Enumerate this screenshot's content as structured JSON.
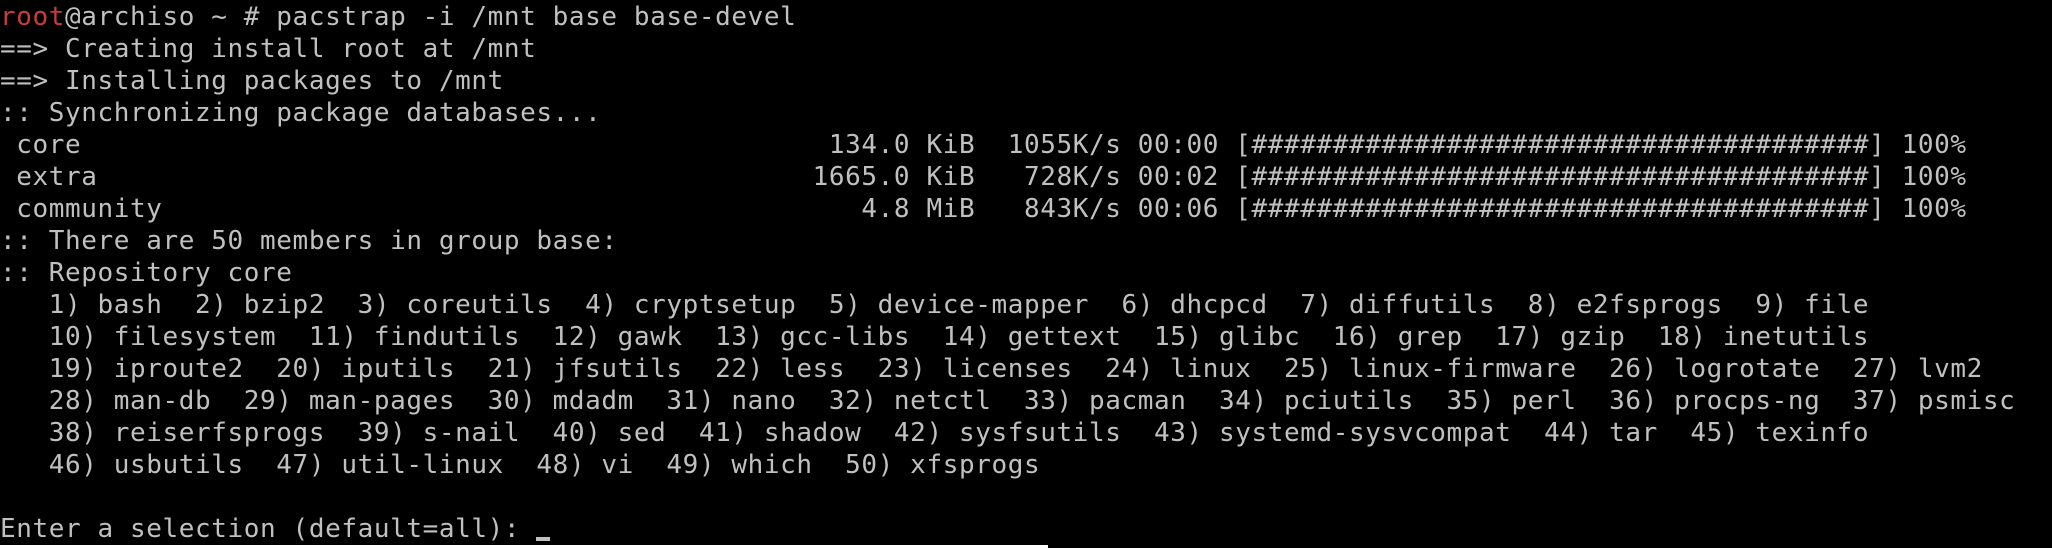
{
  "terminal": {
    "prompt": {
      "user": "root",
      "host_and_command": "@archiso ~ # pacstrap -i /mnt base base-devel"
    },
    "lines": [
      "==> Creating install root at /mnt",
      "==> Installing packages to /mnt",
      ":: Synchronizing package databases..."
    ],
    "sync_rows": [
      " core                                              134.0 KiB  1055K/s 00:00 [######################################] 100%",
      " extra                                            1665.0 KiB   728K/s 00:02 [######################################] 100%",
      " community                                           4.8 MiB   843K/s 00:06 [######################################] 100%"
    ],
    "group_info": ":: There are 50 members in group base:",
    "repository": ":: Repository core",
    "package_lines": [
      "   1) bash  2) bzip2  3) coreutils  4) cryptsetup  5) device-mapper  6) dhcpcd  7) diffutils  8) e2fsprogs  9) file",
      "   10) filesystem  11) findutils  12) gawk  13) gcc-libs  14) gettext  15) glibc  16) grep  17) gzip  18) inetutils",
      "   19) iproute2  20) iputils  21) jfsutils  22) less  23) licenses  24) linux  25) linux-firmware  26) logrotate  27) lvm2",
      "   28) man-db  29) man-pages  30) mdadm  31) nano  32) netctl  33) pacman  34) pciutils  35) perl  36) procps-ng  37) psmisc",
      "   38) reiserfsprogs  39) s-nail  40) sed  41) shadow  42) sysfsutils  43) systemd-sysvcompat  44) tar  45) texinfo",
      "   46) usbutils  47) util-linux  48) vi  49) which  50) xfsprogs"
    ],
    "selection_prompt": "Enter a selection (default=all): "
  },
  "colors": {
    "background": "#000000",
    "foreground": "#c0c0c0",
    "prompt_user": "#c83c3c"
  }
}
